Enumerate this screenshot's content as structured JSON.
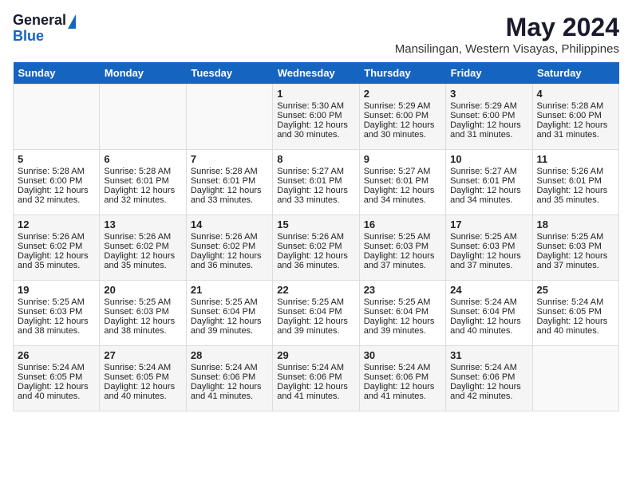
{
  "logo": {
    "general": "General",
    "blue": "Blue"
  },
  "title": "May 2024",
  "location": "Mansilingan, Western Visayas, Philippines",
  "days_header": [
    "Sunday",
    "Monday",
    "Tuesday",
    "Wednesday",
    "Thursday",
    "Friday",
    "Saturday"
  ],
  "weeks": [
    [
      {
        "day": "",
        "info": ""
      },
      {
        "day": "",
        "info": ""
      },
      {
        "day": "",
        "info": ""
      },
      {
        "day": "1",
        "info": "Sunrise: 5:30 AM\nSunset: 6:00 PM\nDaylight: 12 hours\nand 30 minutes."
      },
      {
        "day": "2",
        "info": "Sunrise: 5:29 AM\nSunset: 6:00 PM\nDaylight: 12 hours\nand 30 minutes."
      },
      {
        "day": "3",
        "info": "Sunrise: 5:29 AM\nSunset: 6:00 PM\nDaylight: 12 hours\nand 31 minutes."
      },
      {
        "day": "4",
        "info": "Sunrise: 5:28 AM\nSunset: 6:00 PM\nDaylight: 12 hours\nand 31 minutes."
      }
    ],
    [
      {
        "day": "5",
        "info": "Sunrise: 5:28 AM\nSunset: 6:00 PM\nDaylight: 12 hours\nand 32 minutes."
      },
      {
        "day": "6",
        "info": "Sunrise: 5:28 AM\nSunset: 6:01 PM\nDaylight: 12 hours\nand 32 minutes."
      },
      {
        "day": "7",
        "info": "Sunrise: 5:28 AM\nSunset: 6:01 PM\nDaylight: 12 hours\nand 33 minutes."
      },
      {
        "day": "8",
        "info": "Sunrise: 5:27 AM\nSunset: 6:01 PM\nDaylight: 12 hours\nand 33 minutes."
      },
      {
        "day": "9",
        "info": "Sunrise: 5:27 AM\nSunset: 6:01 PM\nDaylight: 12 hours\nand 34 minutes."
      },
      {
        "day": "10",
        "info": "Sunrise: 5:27 AM\nSunset: 6:01 PM\nDaylight: 12 hours\nand 34 minutes."
      },
      {
        "day": "11",
        "info": "Sunrise: 5:26 AM\nSunset: 6:01 PM\nDaylight: 12 hours\nand 35 minutes."
      }
    ],
    [
      {
        "day": "12",
        "info": "Sunrise: 5:26 AM\nSunset: 6:02 PM\nDaylight: 12 hours\nand 35 minutes."
      },
      {
        "day": "13",
        "info": "Sunrise: 5:26 AM\nSunset: 6:02 PM\nDaylight: 12 hours\nand 35 minutes."
      },
      {
        "day": "14",
        "info": "Sunrise: 5:26 AM\nSunset: 6:02 PM\nDaylight: 12 hours\nand 36 minutes."
      },
      {
        "day": "15",
        "info": "Sunrise: 5:26 AM\nSunset: 6:02 PM\nDaylight: 12 hours\nand 36 minutes."
      },
      {
        "day": "16",
        "info": "Sunrise: 5:25 AM\nSunset: 6:03 PM\nDaylight: 12 hours\nand 37 minutes."
      },
      {
        "day": "17",
        "info": "Sunrise: 5:25 AM\nSunset: 6:03 PM\nDaylight: 12 hours\nand 37 minutes."
      },
      {
        "day": "18",
        "info": "Sunrise: 5:25 AM\nSunset: 6:03 PM\nDaylight: 12 hours\nand 37 minutes."
      }
    ],
    [
      {
        "day": "19",
        "info": "Sunrise: 5:25 AM\nSunset: 6:03 PM\nDaylight: 12 hours\nand 38 minutes."
      },
      {
        "day": "20",
        "info": "Sunrise: 5:25 AM\nSunset: 6:03 PM\nDaylight: 12 hours\nand 38 minutes."
      },
      {
        "day": "21",
        "info": "Sunrise: 5:25 AM\nSunset: 6:04 PM\nDaylight: 12 hours\nand 39 minutes."
      },
      {
        "day": "22",
        "info": "Sunrise: 5:25 AM\nSunset: 6:04 PM\nDaylight: 12 hours\nand 39 minutes."
      },
      {
        "day": "23",
        "info": "Sunrise: 5:25 AM\nSunset: 6:04 PM\nDaylight: 12 hours\nand 39 minutes."
      },
      {
        "day": "24",
        "info": "Sunrise: 5:24 AM\nSunset: 6:04 PM\nDaylight: 12 hours\nand 40 minutes."
      },
      {
        "day": "25",
        "info": "Sunrise: 5:24 AM\nSunset: 6:05 PM\nDaylight: 12 hours\nand 40 minutes."
      }
    ],
    [
      {
        "day": "26",
        "info": "Sunrise: 5:24 AM\nSunset: 6:05 PM\nDaylight: 12 hours\nand 40 minutes."
      },
      {
        "day": "27",
        "info": "Sunrise: 5:24 AM\nSunset: 6:05 PM\nDaylight: 12 hours\nand 40 minutes."
      },
      {
        "day": "28",
        "info": "Sunrise: 5:24 AM\nSunset: 6:06 PM\nDaylight: 12 hours\nand 41 minutes."
      },
      {
        "day": "29",
        "info": "Sunrise: 5:24 AM\nSunset: 6:06 PM\nDaylight: 12 hours\nand 41 minutes."
      },
      {
        "day": "30",
        "info": "Sunrise: 5:24 AM\nSunset: 6:06 PM\nDaylight: 12 hours\nand 41 minutes."
      },
      {
        "day": "31",
        "info": "Sunrise: 5:24 AM\nSunset: 6:06 PM\nDaylight: 12 hours\nand 42 minutes."
      },
      {
        "day": "",
        "info": ""
      }
    ]
  ]
}
